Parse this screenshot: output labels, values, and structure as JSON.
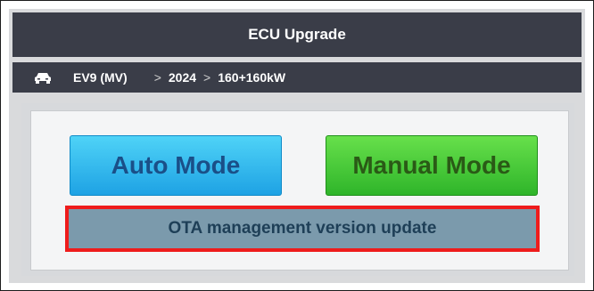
{
  "header": {
    "title": "ECU Upgrade"
  },
  "breadcrumb": {
    "model": "EV9 (MV)",
    "year": "2024",
    "power": "160+160kW",
    "separator": ">"
  },
  "buttons": {
    "auto_mode": "Auto Mode",
    "manual_mode": "Manual Mode",
    "ota_update": "OTA management version update"
  },
  "icons": {
    "vehicle": "car-icon"
  },
  "colors": {
    "title_bar": "#3a3d48",
    "auto_mode": "#1ea2e4",
    "manual_mode": "#2fb52a",
    "ota": "#7b9aac",
    "highlight": "#ee1c1c"
  }
}
